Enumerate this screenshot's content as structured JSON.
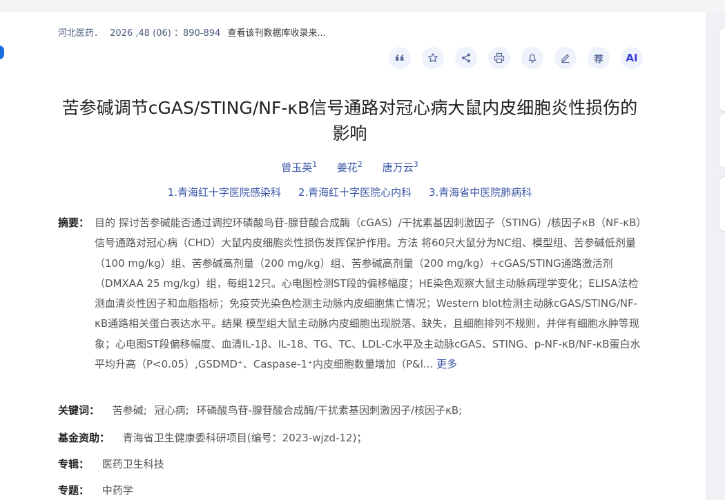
{
  "source": {
    "journal": "河北医药．",
    "issue": "2026 ,48 (06) ：890-894",
    "link": "查看该刊数据库收录来..."
  },
  "toolbar": {
    "icons": [
      "quote-icon",
      "star-icon",
      "share-icon",
      "print-icon",
      "bell-icon",
      "edit-icon",
      "recommend-icon",
      "ai-icon"
    ],
    "recommend_label": "荐",
    "ai_label": "AI"
  },
  "title": "苦参碱调节cGAS/STING/NF-κB信号通路对冠心病大鼠内皮细胞炎性损伤的影响",
  "authors": [
    {
      "name": "曾玉英",
      "sup": "1"
    },
    {
      "name": "姜花",
      "sup": "2"
    },
    {
      "name": "唐万云",
      "sup": "3"
    }
  ],
  "organizations": [
    "1.青海红十字医院感染科",
    "2.青海红十字医院心内科",
    "3.青海省中医院肺病科"
  ],
  "abstract": {
    "label": "摘要：",
    "text": "目的 探讨苦参碱能否通过调控环磷酸鸟苷-腺苷酸合成酶（cGAS）/干扰素基因刺激因子（STING）/核因子κB（NF-κB）信号通路对冠心病（CHD）大鼠内皮细胞炎性损伤发挥保护作用。方法 将60只大鼠分为NC组、模型组、苦参碱低剂量（100 mg/kg）组、苦参碱高剂量（200 mg/kg）组、苦参碱高剂量（200 mg/kg）+cGAS/STING通路激活剂（DMXAA 25 mg/kg）组，每组12只。心电图检测ST段的偏移幅度；HE染色观察大鼠主动脉病理学变化；ELISA法检测血清炎性因子和血脂指标；免疫荧光染色检测主动脉内皮细胞焦亡情况；Western blot检测主动脉cGAS/STING/NF-κB通路相关蛋白表达水平。结果 模型组大鼠主动脉内皮细胞出现脱落、缺失，且细胞排列不规则，并伴有细胞水肿等现象；心电图ST段偏移幅度、血清IL-1β、IL-18、TG、TC、LDL-C水平及主动脉cGAS、STING、p-NF-κB/NF-κB蛋白水平均升高（P<0.05）,GSDMD⁺、Caspase-1⁺内皮细胞数量增加（P&l...",
    "more": "更多"
  },
  "keywords": {
    "label": "关键词：",
    "items": [
      "苦参碱;",
      "冠心病;",
      "环磷酸鸟苷-腺苷酸合成酶/干扰素基因刺激因子/核因子κB;"
    ]
  },
  "fund": {
    "label": "基金资助：",
    "value": "青海省卫生健康委科研项目(编号：2023-wjzd-12)；"
  },
  "series": {
    "label": "专辑：",
    "value": "医药卫生科技"
  },
  "topic": {
    "label": "专题：",
    "value": "中药学"
  }
}
